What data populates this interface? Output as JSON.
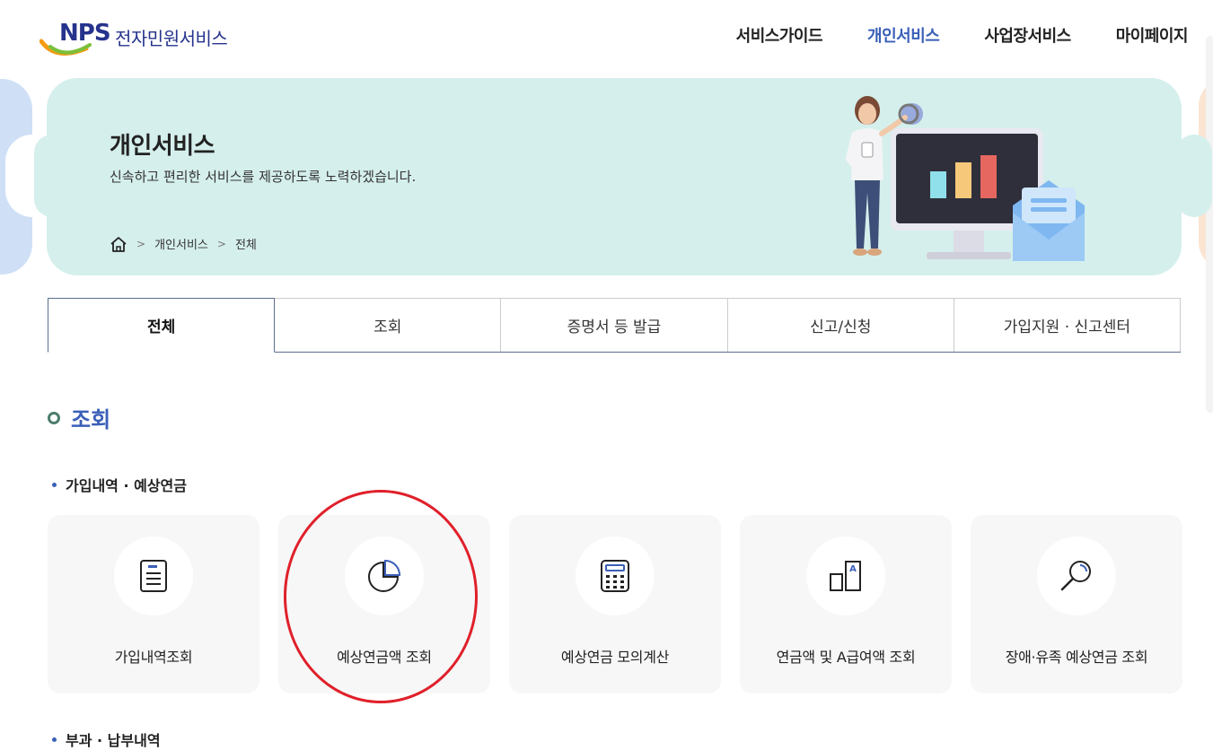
{
  "header": {
    "logo_mark": "NPS",
    "logo_text": "전자민원서비스",
    "nav": [
      {
        "label": "서비스가이드",
        "active": false
      },
      {
        "label": "개인서비스",
        "active": true
      },
      {
        "label": "사업장서비스",
        "active": false
      },
      {
        "label": "마이페이지",
        "active": false
      }
    ]
  },
  "banner": {
    "title": "개인서비스",
    "subtitle": "신속하고 편리한 서비스를 제공하도록 노력하겠습니다.",
    "breadcrumb": [
      "개인서비스",
      "전체"
    ]
  },
  "tabs": [
    "전체",
    "조회",
    "증명서 등 발급",
    "신고/신청",
    "가입지원 · 신고센터"
  ],
  "active_tab": "전체",
  "section": {
    "title": "조회",
    "subsection": "가입내역 · 예상연금",
    "cards": [
      {
        "label": "가입내역조회",
        "icon": "document-icon"
      },
      {
        "label": "예상연금액 조회",
        "icon": "pie-chart-icon"
      },
      {
        "label": "예상연금 모의계산",
        "icon": "calculator-icon"
      },
      {
        "label": "연금액 및 A급여액 조회",
        "icon": "compare-a-icon"
      },
      {
        "label": "장애·유족 예상연금 조회",
        "icon": "magnifier-icon"
      }
    ],
    "next_subsection": "부과 · 납부내역"
  },
  "colors": {
    "brand": "#26338c",
    "active_nav": "#3a5fb8",
    "banner_bg": "#d5efec",
    "highlight_circle": "#e0202a"
  }
}
